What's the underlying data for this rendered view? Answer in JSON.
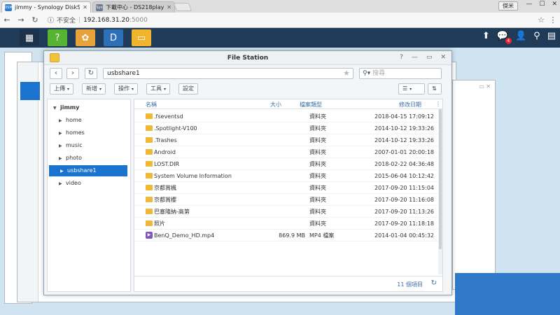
{
  "browser": {
    "tabs": [
      {
        "title": "jimmy - Synology DiskS",
        "favicon": "DSM"
      },
      {
        "title": "下載中心 - DS218play",
        "favicon": "Syn"
      }
    ],
    "profile": "傑米",
    "insecure_label": "不安全",
    "url_host": "192.168.31.20",
    "url_port": ":5000"
  },
  "dsm": {
    "notification_count": "4",
    "apps": [
      "main-menu-icon",
      "support-center-icon",
      "photo-station-icon",
      "download-station-icon",
      "file-station-icon"
    ]
  },
  "file_station": {
    "title": "File Station",
    "path": "usbshare1",
    "search_placeholder": "搜尋",
    "toolbar": {
      "upload": "上傳",
      "create": "新增",
      "action": "操作",
      "tools": "工具",
      "settings": "設定"
    },
    "tree": {
      "root": "jimmy",
      "items": [
        "home",
        "homes",
        "music",
        "photo",
        "usbshare1",
        "video"
      ],
      "selected": "usbshare1"
    },
    "columns": {
      "name": "名稱",
      "size": "大小",
      "type": "檔案類型",
      "modified": "修改日期"
    },
    "files": [
      {
        "name": ".fseventsd",
        "size": "",
        "type": "資料夾",
        "modified": "2018-04-15 17:09:12",
        "kind": "folder"
      },
      {
        "name": ".Spotlight-V100",
        "size": "",
        "type": "資料夾",
        "modified": "2014-10-12 19:33:26",
        "kind": "folder"
      },
      {
        "name": ".Trashes",
        "size": "",
        "type": "資料夾",
        "modified": "2014-10-12 19:33:26",
        "kind": "folder"
      },
      {
        "name": "Android",
        "size": "",
        "type": "資料夾",
        "modified": "2007-01-01 20:00:18",
        "kind": "folder"
      },
      {
        "name": "LOST.DIR",
        "size": "",
        "type": "資料夾",
        "modified": "2018-02-22 04:36:48",
        "kind": "folder"
      },
      {
        "name": "System Volume Information",
        "size": "",
        "type": "資料夾",
        "modified": "2015-06-04 10:12:42",
        "kind": "folder"
      },
      {
        "name": "京都賞楓",
        "size": "",
        "type": "資料夾",
        "modified": "2017-09-20 11:15:04",
        "kind": "folder"
      },
      {
        "name": "京都賞櫻",
        "size": "",
        "type": "資料夾",
        "modified": "2017-09-20 11:16:08",
        "kind": "folder"
      },
      {
        "name": "巴塞隆納-高第",
        "size": "",
        "type": "資料夾",
        "modified": "2017-09-20 11:13:26",
        "kind": "folder"
      },
      {
        "name": "照片",
        "size": "",
        "type": "資料夾",
        "modified": "2017-09-20 11:18:18",
        "kind": "folder"
      },
      {
        "name": "BenQ_Demo_HD.mp4",
        "size": "869.9 MB",
        "type": "MP4 檔案",
        "modified": "2014-01-04 00:45:32",
        "kind": "video"
      }
    ],
    "item_count": "11 個項目"
  }
}
